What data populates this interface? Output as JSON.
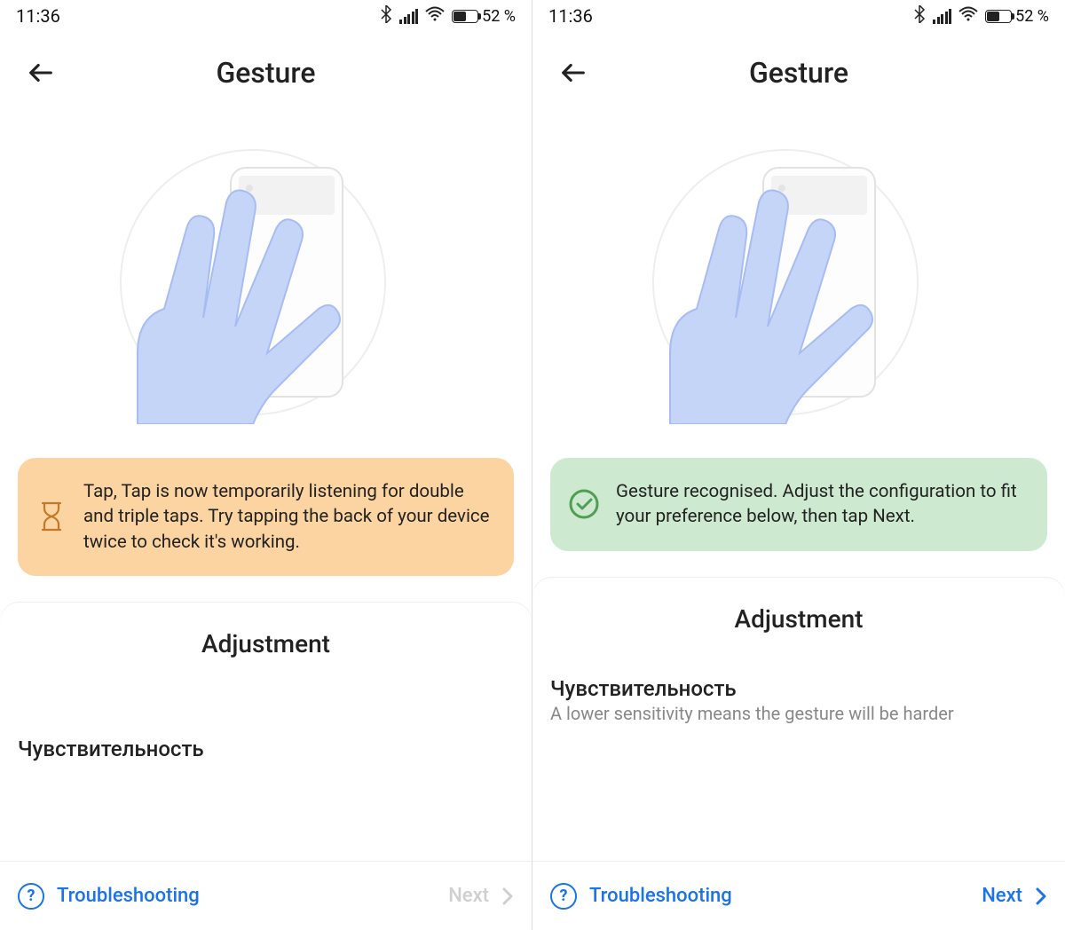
{
  "statusbar": {
    "time": "11:36",
    "battery_pct": "52 %"
  },
  "left": {
    "title": "Gesture",
    "card_text": "Tap, Tap is now temporarily listening for double and triple taps. Try tapping the back of your device twice to check it's working.",
    "section_title": "Adjustment",
    "sensitivity_title": "Чувствительность",
    "sensitivity_desc": "",
    "troubleshooting": "Troubleshooting",
    "next": "Next"
  },
  "right": {
    "title": "Gesture",
    "card_text": "Gesture recognised. Adjust the configuration to fit your preference below, then tap Next.",
    "section_title": "Adjustment",
    "sensitivity_title": "Чувствительность",
    "sensitivity_desc": "A lower sensitivity means the gesture will be harder",
    "troubleshooting": "Troubleshooting",
    "next": "Next"
  }
}
